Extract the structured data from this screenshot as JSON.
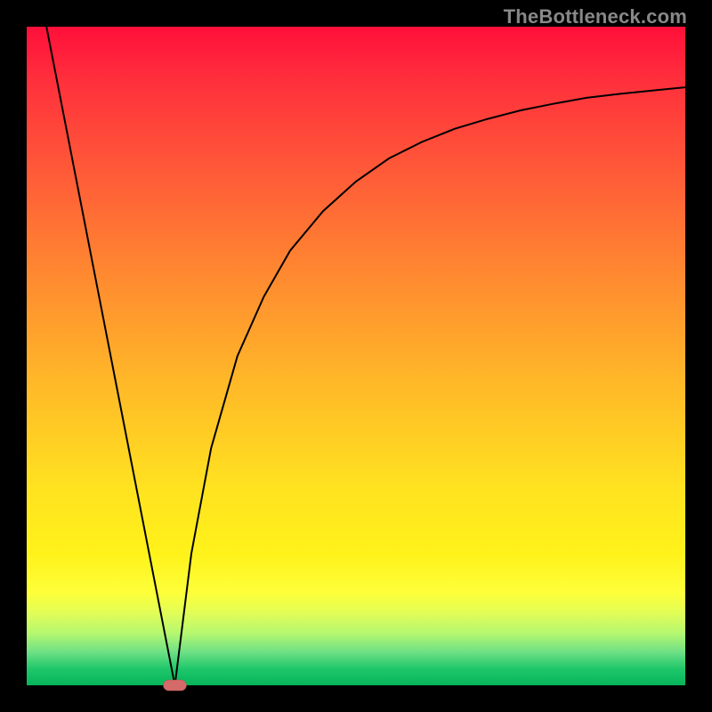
{
  "watermark": "TheBottleneck.com",
  "colors": {
    "background": "#000000",
    "gradient_top": "#ff0f3a",
    "gradient_mid": "#ffe220",
    "gradient_bottom": "#06b45a",
    "curve": "#000000",
    "marker": "#d46a6a"
  },
  "chart_data": {
    "type": "line",
    "title": "",
    "xlabel": "",
    "ylabel": "",
    "xlim": [
      0,
      100
    ],
    "ylim": [
      0,
      100
    ],
    "grid": false,
    "series": [
      {
        "name": "left-branch",
        "x": [
          3,
          22.5
        ],
        "values": [
          100,
          0
        ]
      },
      {
        "name": "right-branch",
        "x": [
          22.5,
          25,
          28,
          32,
          36,
          40,
          45,
          50,
          55,
          60,
          65,
          70,
          75,
          80,
          85,
          90,
          95,
          100
        ],
        "values": [
          0,
          20,
          36,
          50,
          59,
          66,
          72,
          76.5,
          80,
          82.5,
          84.5,
          86,
          87.3,
          88.3,
          89.2,
          89.8,
          90.3,
          90.8
        ]
      }
    ],
    "annotations": [
      {
        "name": "minimum-marker",
        "x": 22.5,
        "y": 0,
        "shape": "capsule"
      }
    ]
  }
}
